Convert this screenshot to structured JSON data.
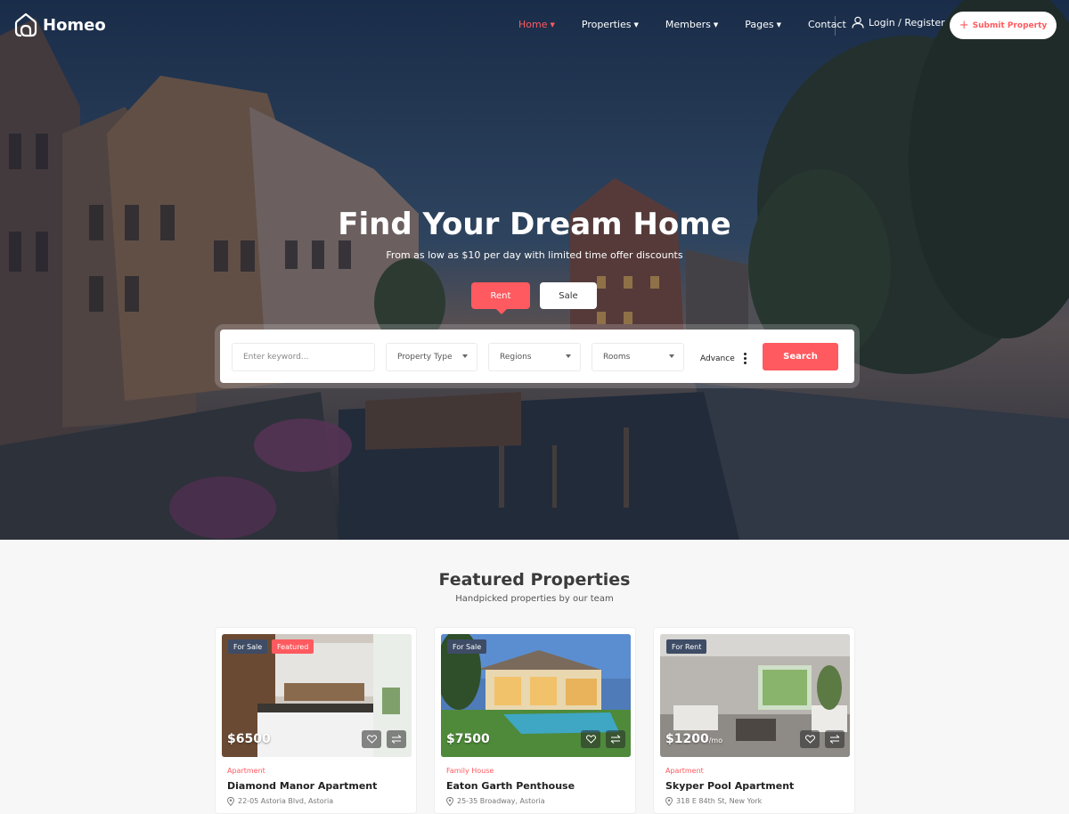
{
  "brand": {
    "name": "Homeo",
    "accent": "#ff5a5f"
  },
  "nav": {
    "items": [
      {
        "label": "Home",
        "dropdown": true,
        "active": true
      },
      {
        "label": "Properties",
        "dropdown": true
      },
      {
        "label": "Members",
        "dropdown": true
      },
      {
        "label": "Pages",
        "dropdown": true
      },
      {
        "label": "Contact",
        "dropdown": false
      }
    ],
    "login_label": "Login / Register",
    "submit_label": "Submit Property"
  },
  "hero": {
    "title": "Find Your Dream Home",
    "subtitle": "From as low as $10 per day with limited time offer discounts",
    "tabs": {
      "rent": "Rent",
      "sale": "Sale"
    },
    "search": {
      "keyword_placeholder": "Enter keyword...",
      "property_type": "Property Type",
      "regions": "Regions",
      "rooms": "Rooms",
      "advance": "Advance",
      "button": "Search"
    }
  },
  "featured": {
    "title": "Featured Properties",
    "subtitle": "Handpicked properties by our team",
    "cards": [
      {
        "status": "For Sale",
        "featured": "Featured",
        "price": "$6500",
        "suffix": "",
        "type": "Apartment",
        "name": "Diamond Manor Apartment",
        "address": "22-05 Astoria Blvd, Astoria"
      },
      {
        "status": "For Sale",
        "featured": "",
        "price": "$7500",
        "suffix": "",
        "type": "Family House",
        "name": "Eaton Garth Penthouse",
        "address": "25-35 Broadway, Astoria"
      },
      {
        "status": "For Rent",
        "featured": "",
        "price": "$1200",
        "suffix": "/mo",
        "type": "Apartment",
        "name": "Skyper Pool Apartment",
        "address": "318 E 84th St, New York"
      }
    ]
  }
}
